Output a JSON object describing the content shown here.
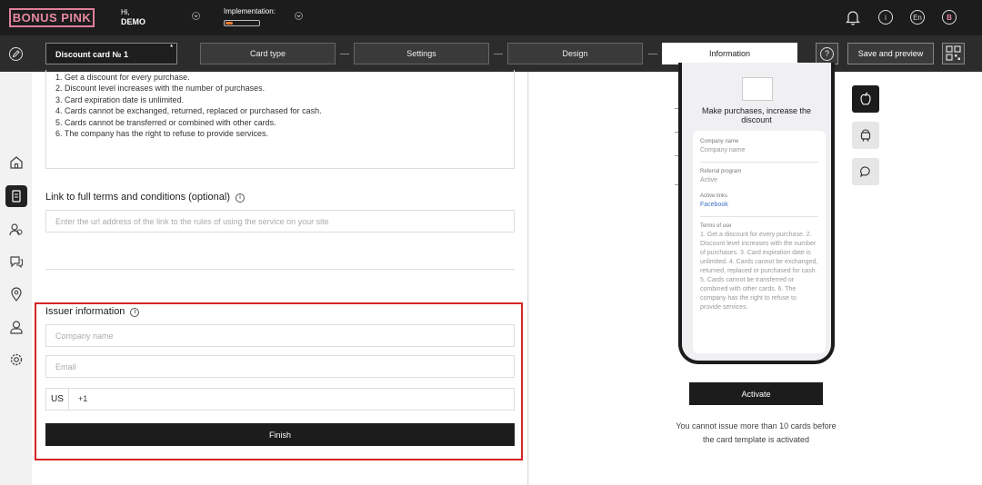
{
  "header": {
    "logo": "BONUS PINK",
    "greeting": "Hi,",
    "user_name": "DEMO",
    "implementation_label": "Implementation:",
    "implementation_progress": 0.2,
    "language": "En",
    "avatar_letter": "B",
    "info_glyph": "i"
  },
  "nav": {
    "card_name": "Discount card № 1",
    "card_star": "*",
    "steps": [
      "Card type",
      "Settings",
      "Design",
      "Information"
    ],
    "active_step": "Information",
    "help_glyph": "?",
    "save_label": "Save and preview"
  },
  "form": {
    "terms_lines": [
      "1. Get a discount for every purchase.",
      "2. Discount level increases with the number of purchases.",
      "3. Card expiration date is unlimited.",
      "4. Cards cannot be exchanged, returned, replaced or purchased for cash.",
      "5. Cards cannot be transferred or combined with other cards.",
      "6. The company has the right to refuse to provide services."
    ],
    "link_label": "Link to full terms and conditions (optional)",
    "link_placeholder": "Enter the url address of the link to the rules of using the service on your site",
    "issuer_label": "Issuer information",
    "company_placeholder": "Company name",
    "email_placeholder": "Email",
    "phone_country": "US",
    "phone_value": "+1",
    "finish_label": "Finish",
    "info_glyph": "i"
  },
  "preview": {
    "title": "Make purchases, increase the discount",
    "company_name_label": "Company name",
    "company_name_value": "Company name",
    "referral_label": "Referral program",
    "referral_value": "Active",
    "links_label": "Active links",
    "links_value": "Facebook",
    "terms_label": "Terms of use",
    "terms_text": "1. Get a discount for every purchase. 2. Discount level increases with the number of purchases. 3. Card expiration date is unlimited. 4. Cards cannot be exchanged, returned, replaced or purchased for cash. 5. Cards cannot be transferred or combined with other cards. 6. The company has the right to refuse to provide services.",
    "activate_label": "Activate",
    "notice": "You cannot issue more than 10 cards before the card template is activated"
  },
  "colors": {
    "brand": "#e88aa3",
    "highlight": "#d62424",
    "progress": "#e8792d",
    "link": "#3a6fc4"
  }
}
